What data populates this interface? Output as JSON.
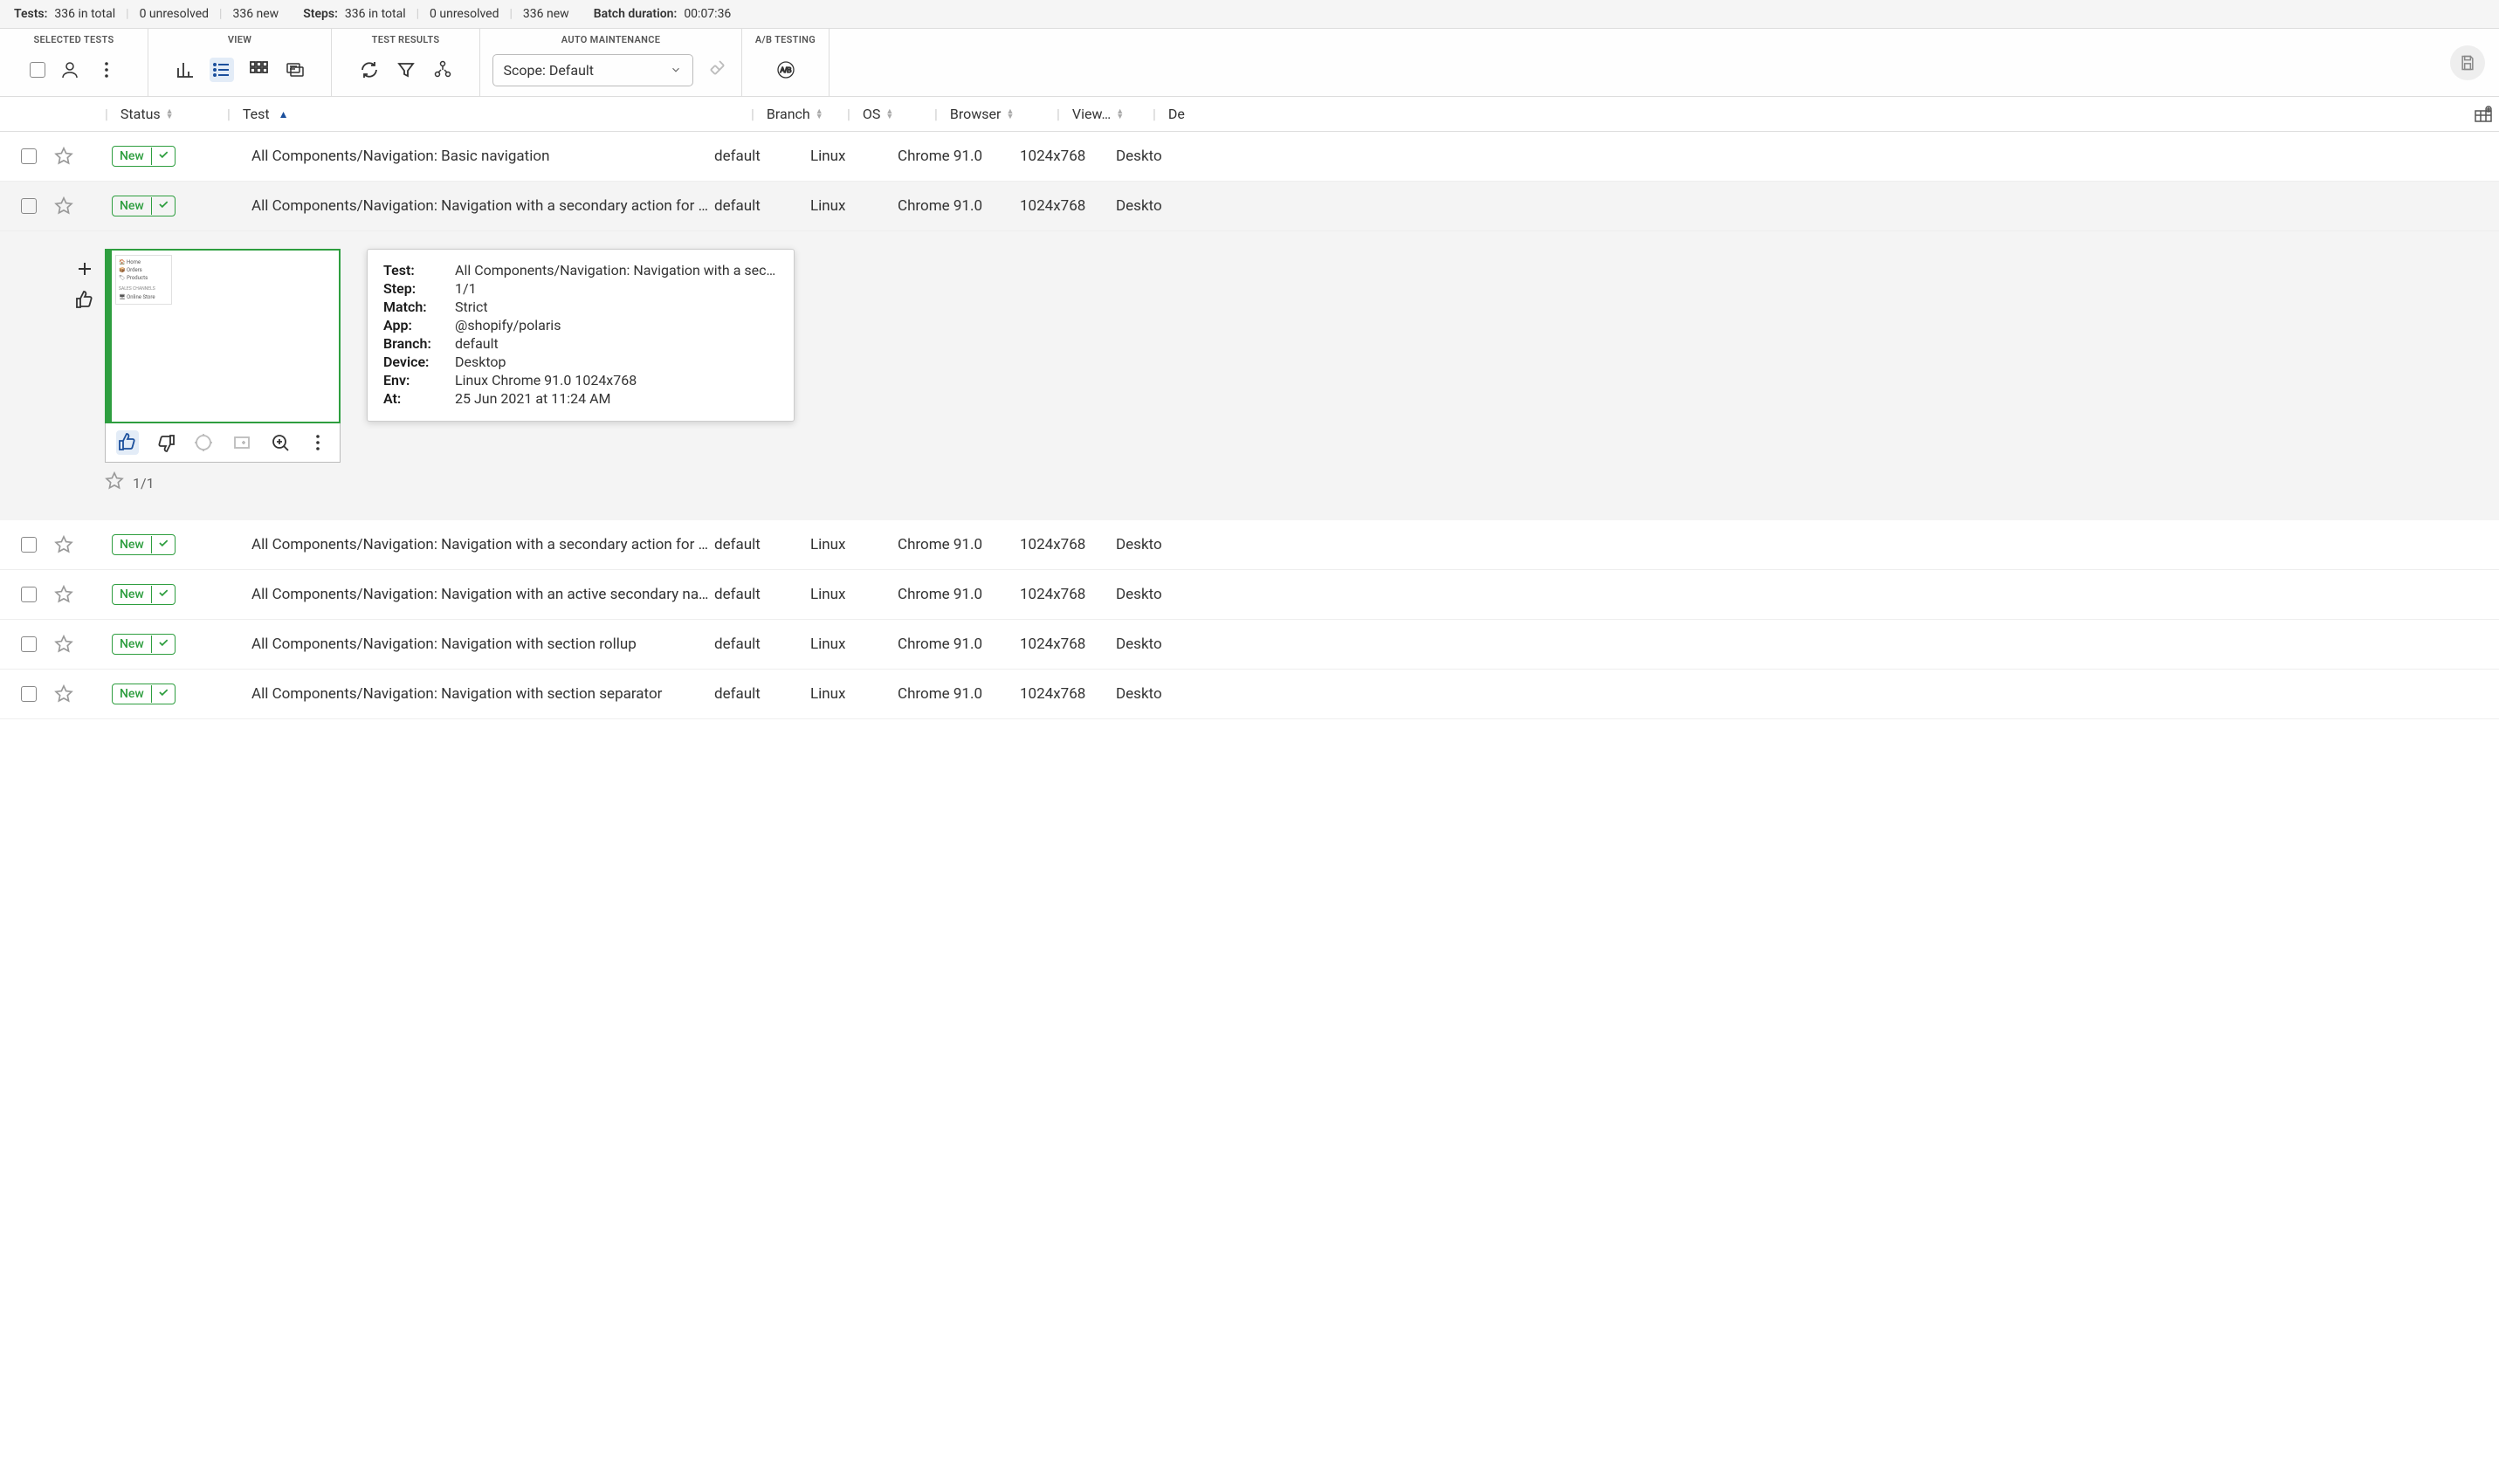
{
  "header": {
    "tests_label": "Tests:",
    "tests_total": "336 in total",
    "tests_unresolved": "0 unresolved",
    "tests_new": "336 new",
    "steps_label": "Steps:",
    "steps_total": "336 in total",
    "steps_unresolved": "0 unresolved",
    "steps_new": "336 new",
    "batch_label": "Batch duration:",
    "batch_duration": "00:07:36"
  },
  "toolbar": {
    "selected_tests": "SELECTED TESTS",
    "view": "VIEW",
    "test_results": "TEST RESULTS",
    "auto_maintenance": "AUTO MAINTENANCE",
    "ab_testing": "A/B TESTING",
    "scope": "Scope: Default"
  },
  "columns": {
    "status": "Status",
    "test": "Test",
    "branch": "Branch",
    "os": "OS",
    "browser": "Browser",
    "view": "View…",
    "device": "De"
  },
  "rows": [
    {
      "status": "New",
      "test": "All Components/Navigation: Basic navigation",
      "branch": "default",
      "os": "Linux",
      "browser": "Chrome 91.0",
      "viewport": "1024x768",
      "device": "Deskto"
    },
    {
      "status": "New",
      "test": "All Components/Navigation: Navigation with a secondary action for a section …",
      "branch": "default",
      "os": "Linux",
      "browser": "Chrome 91.0",
      "viewport": "1024x768",
      "device": "Deskto"
    },
    {
      "status": "New",
      "test": "All Components/Navigation: Navigation with a secondary action for an item",
      "branch": "default",
      "os": "Linux",
      "browser": "Chrome 91.0",
      "viewport": "1024x768",
      "device": "Deskto"
    },
    {
      "status": "New",
      "test": "All Components/Navigation: Navigation with an active secondary navigation it…",
      "branch": "default",
      "os": "Linux",
      "browser": "Chrome 91.0",
      "viewport": "1024x768",
      "device": "Deskto"
    },
    {
      "status": "New",
      "test": "All Components/Navigation: Navigation with section rollup",
      "branch": "default",
      "os": "Linux",
      "browser": "Chrome 91.0",
      "viewport": "1024x768",
      "device": "Deskto"
    },
    {
      "status": "New",
      "test": "All Components/Navigation: Navigation with section separator",
      "branch": "default",
      "os": "Linux",
      "browser": "Chrome 91.0",
      "viewport": "1024x768",
      "device": "Deskto"
    }
  ],
  "expanded": {
    "step_count": "1/1",
    "tooltip": {
      "test_label": "Test:",
      "test_val": "All Components/Navigation: Navigation with a sec…",
      "step_label": "Step:",
      "step_val": "1/1",
      "match_label": "Match:",
      "match_val": "Strict",
      "app_label": "App:",
      "app_val": "@shopify/polaris",
      "branch_label": "Branch:",
      "branch_val": "default",
      "device_label": "Device:",
      "device_val": "Desktop",
      "env_label": "Env:",
      "env_val": "Linux Chrome 91.0 1024x768",
      "at_label": "At:",
      "at_val": "25 Jun 2021 at 11:24 AM"
    }
  },
  "thumb": {
    "l1": "🏠 Home",
    "l2": "📦 Orders",
    "l3": "🏷 Products",
    "l4": "SALES CHANNELS",
    "l5": "🖥 Online Store"
  }
}
